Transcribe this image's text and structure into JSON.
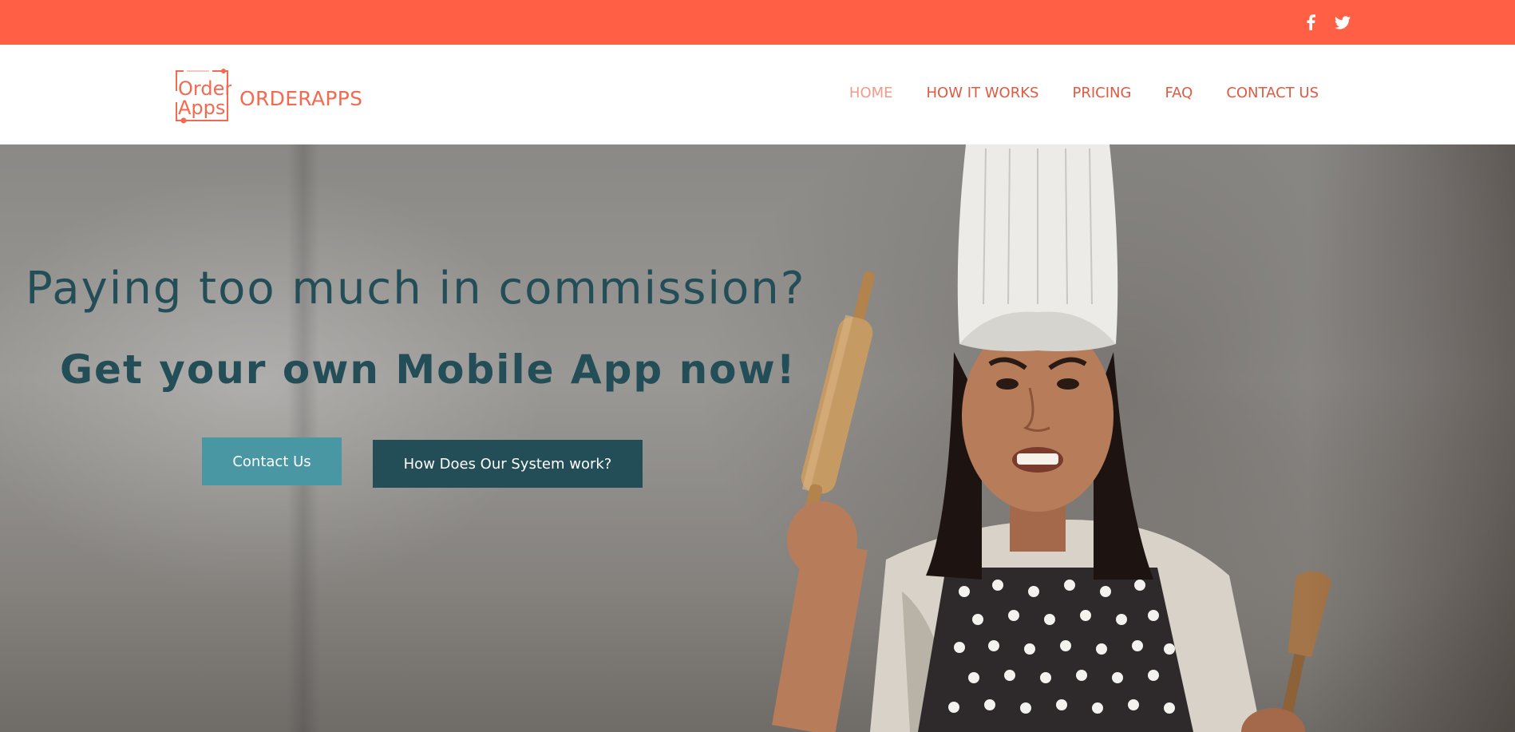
{
  "topbar": {
    "background": "#ff6045",
    "social": [
      {
        "icon": "facebook-icon"
      },
      {
        "icon": "twitter-icon"
      }
    ]
  },
  "header": {
    "logo_text": [
      "Order",
      "Apps"
    ],
    "brand": "ORDERAPPS",
    "nav": [
      {
        "label": "HOME",
        "active": true
      },
      {
        "label": "HOW IT WORKS",
        "active": false
      },
      {
        "label": "PRICING",
        "active": false
      },
      {
        "label": "FAQ",
        "active": false
      },
      {
        "label": "CONTACT US",
        "active": false
      }
    ]
  },
  "hero": {
    "headline": "Paying too much in commission?",
    "subline": "Get your own Mobile App now!",
    "buttons": {
      "contact": "Contact Us",
      "how": "How Does Our System work?"
    },
    "image": "angry-chef-with-rolling-pin-illustration"
  },
  "colors": {
    "accent": "#ff6045",
    "nav_text": "#e05a42",
    "nav_active": "#f39a88",
    "heading": "#234e58",
    "btn_contact": "#4a97a4",
    "btn_how": "#234e58"
  }
}
